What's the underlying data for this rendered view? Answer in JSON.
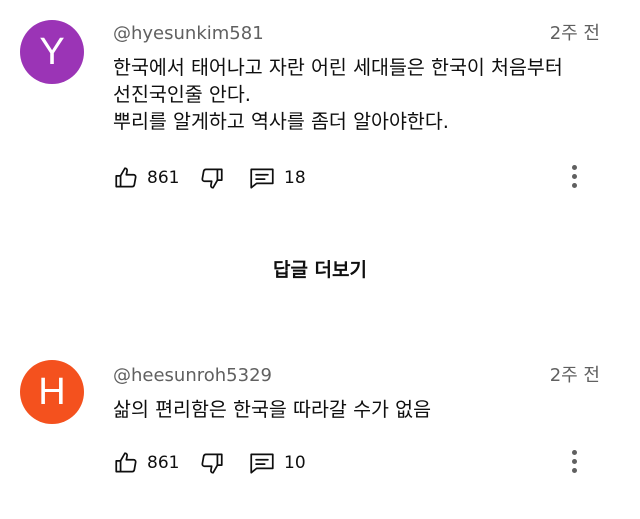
{
  "comments": [
    {
      "avatar_letter": "Y",
      "avatar_color": "#9b34b6",
      "handle": "@hyesunkim581",
      "time": "2주 전",
      "lines": [
        "한국에서 태어나고 자란 어린 세대들은 한국이 처음부터",
        "선진국인줄 안다.",
        "뿌리를 알게하고 역사를 좀더 알아야한다."
      ],
      "likes": "861",
      "replies": "18"
    },
    {
      "avatar_letter": "H",
      "avatar_color": "#f4511e",
      "handle": "@heesunroh5329",
      "time": "2주 전",
      "lines": [
        "삶의 편리함은 한국을 따라갈 수가 없음"
      ],
      "likes": "861",
      "replies": "10"
    }
  ],
  "show_replies_label": "답글 더보기",
  "icons": {
    "like": "thumbs-up-icon",
    "dislike": "thumbs-down-icon",
    "reply": "comment-icon",
    "more": "more-vertical-icon"
  }
}
